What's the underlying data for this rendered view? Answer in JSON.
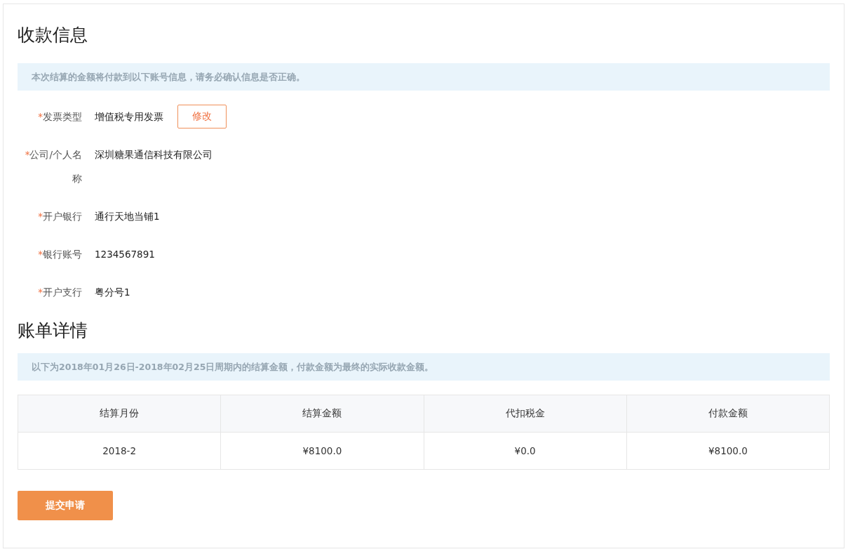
{
  "payment_info": {
    "title": "收款信息",
    "notice": "本次结算的金额将付款到以下账号信息，请务必确认信息是否正确。",
    "fields": [
      {
        "required_mark": "*",
        "label": "发票类型",
        "value": "增值税专用发票",
        "action": "修改"
      },
      {
        "required_mark": "*",
        "label": "公司/个人名称",
        "value": "深圳糖果通信科技有限公司"
      },
      {
        "required_mark": "*",
        "label": "开户银行",
        "value": "通行天地当铺1"
      },
      {
        "required_mark": "*",
        "label": "银行账号",
        "value": "1234567891"
      },
      {
        "required_mark": "*",
        "label": "开户支行",
        "value": "粤分号1"
      }
    ]
  },
  "bill_details": {
    "title": "账单详情",
    "notice": "以下为2018年01月26日-2018年02月25日周期内的结算金额，付款金额为最终的实际收款金额。",
    "table": {
      "columns": [
        "结算月份",
        "结算金额",
        "代扣税金",
        "付款金额"
      ],
      "rows": [
        [
          "2018-2",
          "¥8100.0",
          "¥0.0",
          "¥8100.0"
        ]
      ]
    }
  },
  "submit_button": "提交申请"
}
